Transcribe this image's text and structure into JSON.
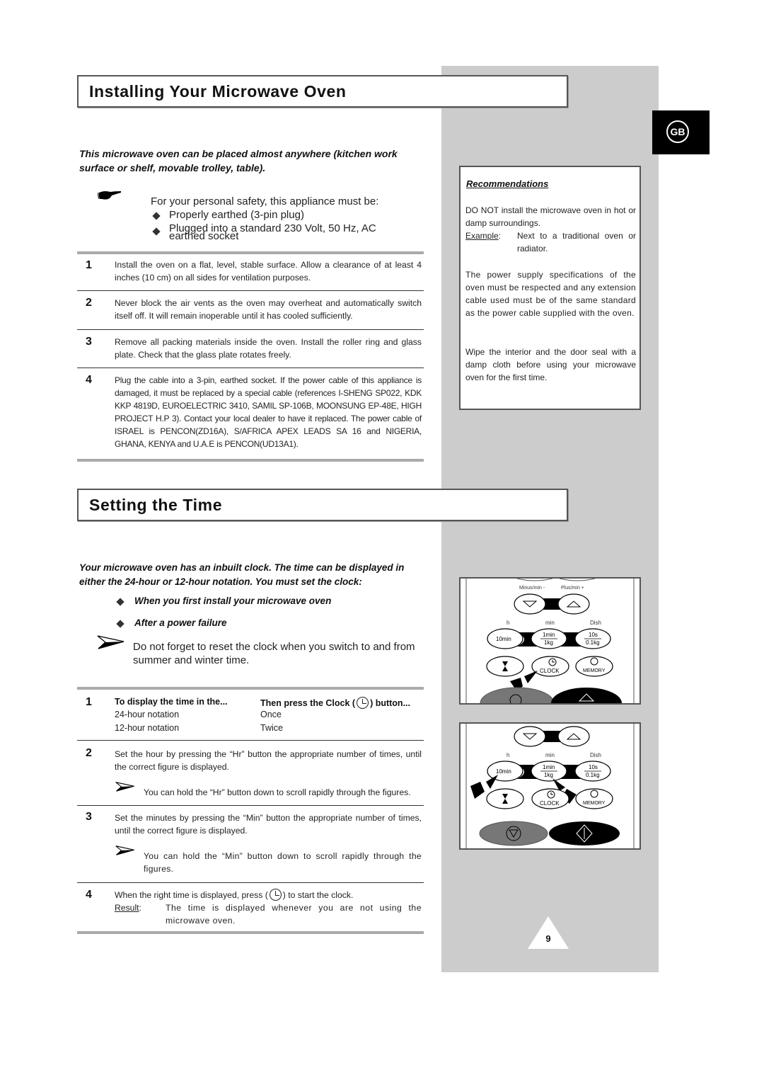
{
  "language_tab": "GB",
  "page_number": "9",
  "installing": {
    "title": "Installing Your Microwave Oven",
    "intro": "This microwave oven can be placed almost anywhere (kitchen work surface or shelf, movable trolley, table).",
    "safety_lead": "For your personal safety, this appliance must be:",
    "safety_bullets": [
      "Properly earthed (3-pin plug)",
      "Plugged into a standard 230 Volt, 50 Hz, AC earthed socket"
    ],
    "steps": [
      {
        "num": "1",
        "text": "Install the oven on a flat, level, stable surface. Allow a clearance of at least 4 inches (10 cm) on all sides for ventilation purposes."
      },
      {
        "num": "2",
        "text": "Never block the air vents as the oven may overheat and automatically switch itself off. It will remain inoperable until it has cooled sufficiently."
      },
      {
        "num": "3",
        "text": "Remove all packing materials inside the oven. Install the roller ring and glass plate. Check that the glass plate rotates freely."
      },
      {
        "num": "4",
        "text": "Plug the cable into a 3-pin, earthed socket. If the power cable of this appliance is damaged, it must be replaced by a special cable (references I-SHENG SP022, KDK KKP 4819D, EUROELECTRIC 3410, SAMIL SP-106B, MOONSUNG EP-48E, HIGH PROJECT H.P 3). Contact your local dealer to have it replaced. The power cable of ISRAEL is PENCON(ZD16A), S/AFRICA APEX LEADS SA 16 and NIGERIA, GHANA, KENYA and U.A.E is PENCON(UD13A1)."
      }
    ]
  },
  "recommendations": {
    "title": "Recommendations",
    "p1": "DO NOT install the microwave oven in hot or damp surroundings.",
    "example_label": "Example",
    "example_text": "Next to a traditional oven or radiator.",
    "p2": "The power supply specifications of the oven must be respected and any extension cable used must be of the same standard as the power cable supplied with the oven.",
    "p3": "Wipe the interior and the door seal with a damp cloth before using your microwave oven for the first time."
  },
  "setting_time": {
    "title": "Setting the Time",
    "intro": "Your microwave oven has an inbuilt clock. The time can be displayed in either the 24-hour or 12-hour notation. You must set the clock:",
    "bullets": [
      "When you first install your microwave oven",
      "After a power failure"
    ],
    "note": "Do not forget to reset the clock when you switch to and from summer and winter time.",
    "table": {
      "head_left": "To display the time in the...",
      "head_right_pre": "Then press the Clock (",
      "head_right_post": ") button...",
      "rows": [
        {
          "notation": "24-hour notation",
          "presses": "Once"
        },
        {
          "notation": "12-hour notation",
          "presses": "Twice"
        }
      ]
    },
    "step2": "Set the hour by pressing the “Hr” button the appropriate number of times, until the correct figure is displayed.",
    "step2_tip": "You can hold the “Hr” button down to scroll rapidly through the figures.",
    "step3": "Set the minutes by pressing the “Min” button the appropriate number of times, until the correct figure is displayed.",
    "step3_tip": "You can hold the “Min” button down to scroll rapidly through the figures.",
    "step4_pre": "When the right time is displayed, press (",
    "step4_post": ") to start the clock.",
    "result_label": "Result",
    "result_text": "The time is displayed whenever you are not using the microwave oven.",
    "step_nums": [
      "1",
      "2",
      "3",
      "4"
    ]
  },
  "control_panel": {
    "minus_label": "Minus/min -",
    "plus_label": "Plus/min +",
    "h_label": "h",
    "min_label": "min",
    "dish_label": "Dish",
    "btn_10min": "10min",
    "btn_1min": "1min",
    "btn_1kg": "1kg",
    "btn_10s": "10s",
    "btn_01kg": "0.1kg",
    "clock_label": "CLOCK",
    "memory_label": "MEMORY"
  }
}
